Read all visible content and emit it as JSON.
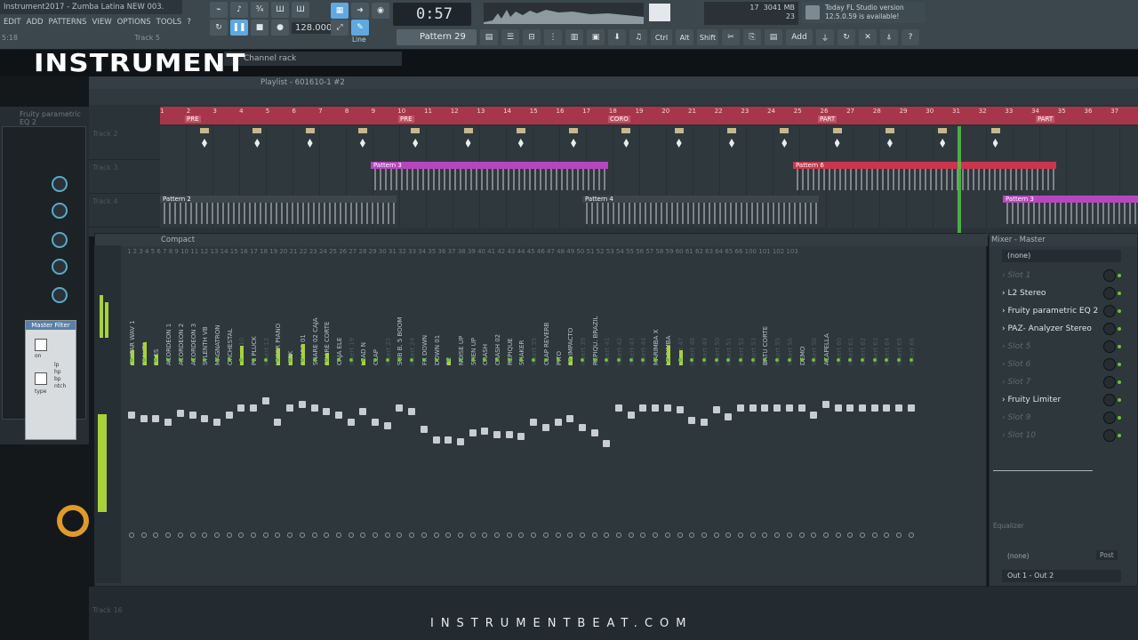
{
  "window": {
    "title": "Instrument2017 - Zumba Latina NEW 003.",
    "track_label": "Track 5",
    "time_hint": "5:18"
  },
  "menu": [
    "EDIT",
    "ADD",
    "PATTERNS",
    "VIEW",
    "OPTIONS",
    "TOOLS",
    "?"
  ],
  "transport": {
    "time": "0:57",
    "time_frac": "14",
    "tempo": "128.000",
    "line_mode": "Line",
    "pattern": "Pattern 29"
  },
  "cpu": {
    "memory": "3041 MB",
    "cpu": "17",
    "poly": "23"
  },
  "news": {
    "line1": "Today  FL Studio version",
    "line2": "12.5.0.59 is available!"
  },
  "toolbar_right": [
    "Ctrl",
    "Alt",
    "Shift",
    "Add"
  ],
  "channel_rack": {
    "title": "Channel rack"
  },
  "logo": "INSTRUMENT",
  "left_panel": {
    "title": "Fruity parametric EQ 2",
    "filter_title": "Master Filter",
    "filter_labels": [
      "lp",
      "hp",
      "bp",
      "ntch"
    ],
    "filter_on": "on",
    "filter_type": "type"
  },
  "playlist": {
    "title": "Playlist - 601610-1 #2",
    "markers": [
      "PRE",
      "PRE",
      "CORO",
      "PART",
      "PART"
    ],
    "tracks": [
      {
        "name": "Track 2",
        "clips": [
          "",
          "",
          "",
          "",
          "",
          "",
          "",
          "",
          "",
          "",
          "",
          "",
          "",
          "",
          "",
          ""
        ]
      },
      {
        "name": "Track 3",
        "patterns": [
          "Pattern 3",
          "Pattern 6"
        ]
      },
      {
        "name": "Track 4",
        "patterns": [
          "Pattern 2",
          "Pattern 4",
          "Pattern 3"
        ]
      }
    ],
    "bottom_track": "Track 16"
  },
  "mixer": {
    "title": "Compact",
    "channels": [
      "Master",
      "GUITAR WAV 1",
      "FLAUTA",
      "BASS",
      "ACORDEON 1",
      "ACORDEON 2",
      "ACORDEON 3",
      "SYLENTH VB",
      "MAGNATRON",
      "ORCHESTAL",
      "Insert 10",
      "PL PLUCK",
      "Insert 12",
      "HYPER PIANO",
      "KICK",
      "SNARE 01",
      "SNARE 02 CAJA",
      "SNARE CORTE",
      "CAJA ELE",
      "Insert 19",
      "LEAD N",
      "CLAP",
      "Insert 22",
      "SUB B. 5 BOOM",
      "Insert 24",
      "FX DOWN",
      "DOWN 01",
      "R2",
      "NOISE UP",
      "SHEN UP",
      "CRASH",
      "CRASH 02",
      "REPIQUE",
      "SHAKER",
      "Insert 35",
      "CLAP REVERB",
      "PITO",
      "FX IMPACTO",
      "Insert 39",
      "REPIQU. BRAZIL",
      "Insert 41",
      "Insert 42",
      "Insert 43",
      "Insert 44",
      "MARIMBA X",
      "MARIMBA",
      "Insert 47",
      "Insert 48",
      "Insert 49",
      "Insert 50",
      "Insert 51",
      "Insert 52",
      "Insert 53",
      "BATU CORTE",
      "Insert 55",
      "Insert 56",
      "DEMO",
      "Insert 58",
      "ACAPELLA",
      "Insert 60",
      "Insert 61",
      "Insert 62",
      "Insert 63",
      "Insert 64",
      "Insert 65",
      "Insert 66"
    ],
    "numbers": [
      "1",
      "2",
      "3",
      "4",
      "5",
      "6",
      "7",
      "8",
      "9",
      "10",
      "11",
      "12",
      "13",
      "14",
      "15",
      "16",
      "17",
      "18",
      "19",
      "20",
      "21",
      "22",
      "23",
      "24",
      "25",
      "26",
      "27",
      "28",
      "29",
      "30",
      "31",
      "32",
      "33",
      "34",
      "35",
      "36",
      "37",
      "38",
      "39",
      "40",
      "41",
      "42",
      "43",
      "44",
      "45",
      "46",
      "47",
      "48",
      "49",
      "50",
      "51",
      "52",
      "53",
      "54",
      "55",
      "56",
      "57",
      "58",
      "59",
      "60",
      "61",
      "62",
      "63",
      "64",
      "65",
      "66",
      "100",
      "101",
      "102",
      "103"
    ]
  },
  "mixer_right": {
    "title": "Mixer - Master",
    "input": "(none)",
    "slots": [
      {
        "label": "Slot 1",
        "empty": true
      },
      {
        "label": "L2 Stereo",
        "empty": false
      },
      {
        "label": "Fruity parametric EQ 2",
        "empty": false
      },
      {
        "label": "PAZ- Analyzer Stereo",
        "empty": false
      },
      {
        "label": "Slot 5",
        "empty": true
      },
      {
        "label": "Slot 6",
        "empty": true
      },
      {
        "label": "Slot 7",
        "empty": true
      },
      {
        "label": "Fruity Limiter",
        "empty": false
      },
      {
        "label": "Slot 9",
        "empty": true
      },
      {
        "label": "Slot 10",
        "empty": true
      }
    ],
    "equalizer": "Equalizer",
    "sidechain": "(none)",
    "post": "Post",
    "output": "Out 1 - Out 2"
  },
  "watermark": "INSTRUMENTBEAT.COM",
  "colors": {
    "accent": "#5fa8e0",
    "meter": "#a7d23a",
    "ruler": "#a8364a",
    "pattern_purple": "#c04fc7",
    "pattern_red": "#c9364d",
    "playhead": "#58c94d"
  }
}
